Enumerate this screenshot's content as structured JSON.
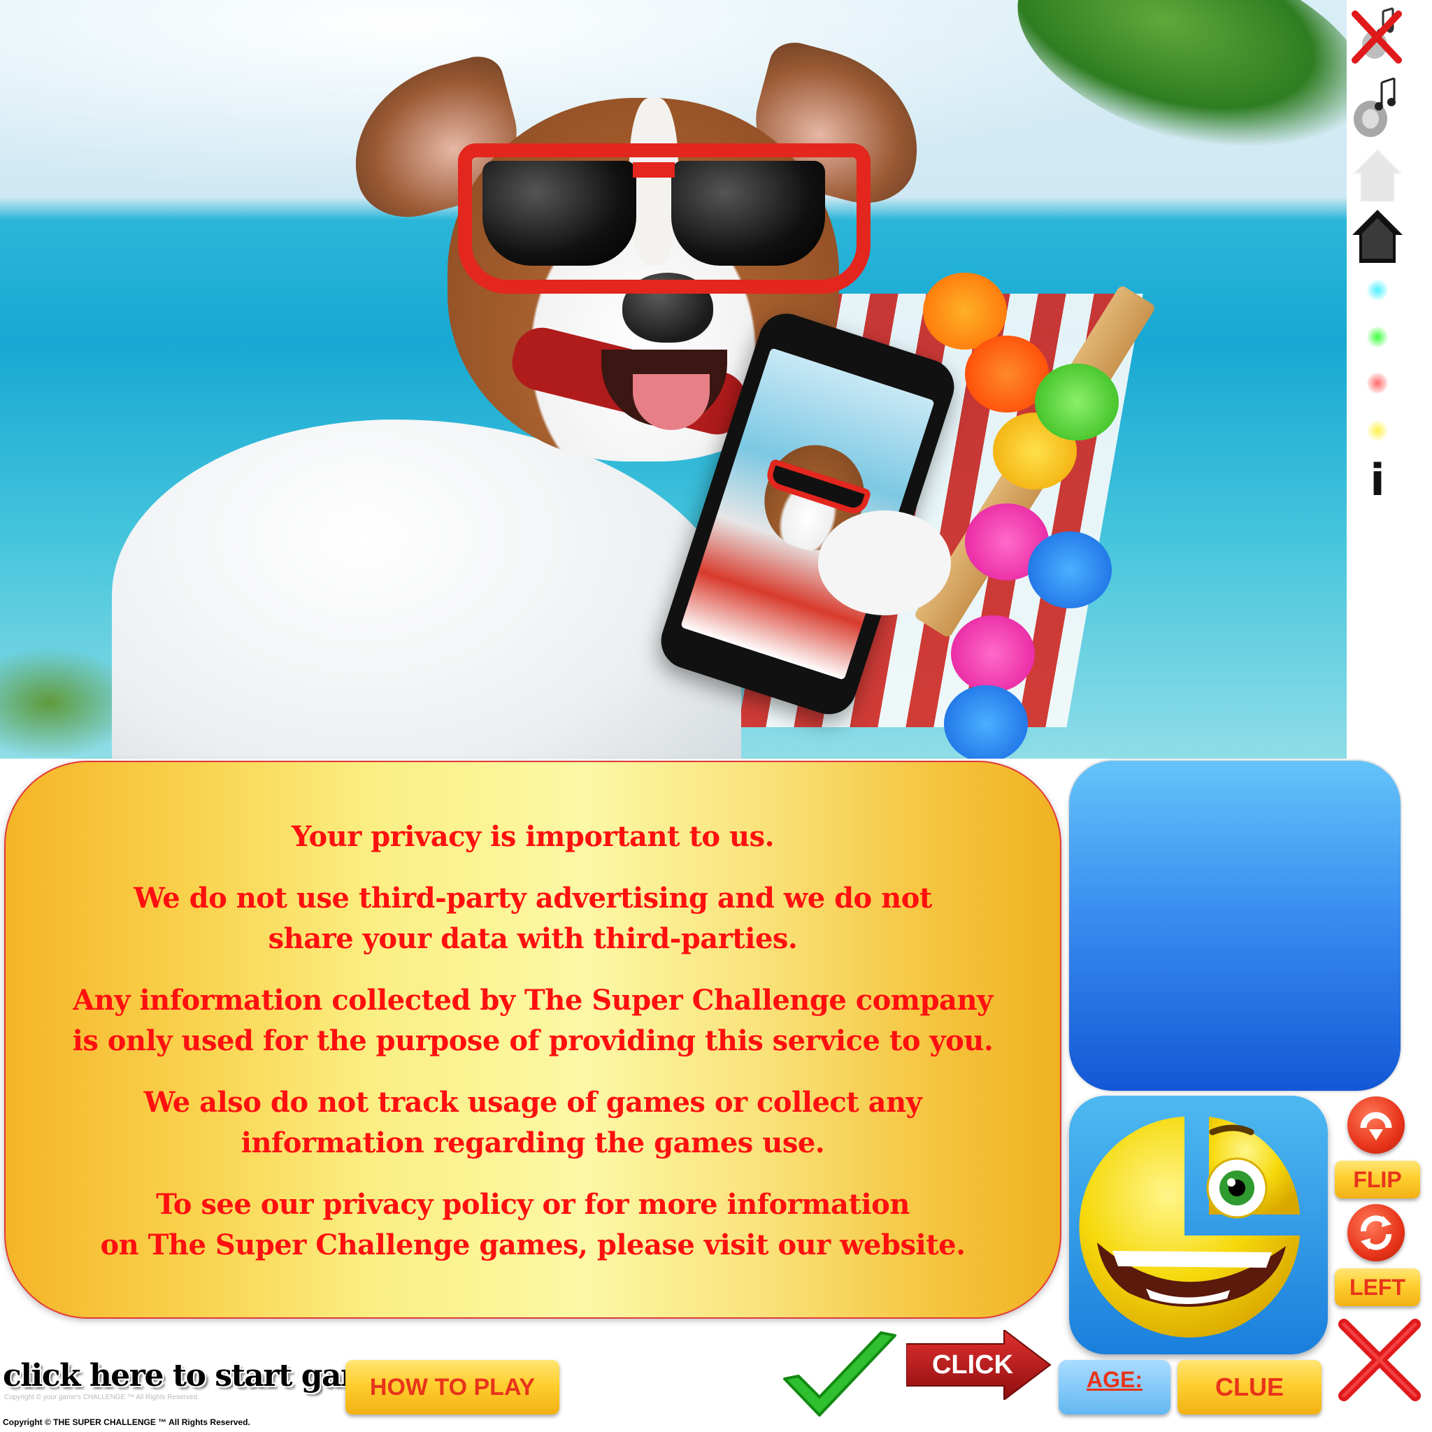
{
  "privacy_message": {
    "paragraphs": [
      "Your privacy is important to us.",
      "We do not use third-party advertising and we do not\nshare your data with third-parties.",
      "Any information collected by The Super Challenge company\nis only used for the purpose of providing this service to you.",
      "We also do not track usage of games or collect any\ninformation regarding the games use.",
      "To see our privacy policy or for more information\non The Super Challenge games, please visit our website."
    ]
  },
  "toolbar": {
    "icons": [
      "sound-off-icon",
      "music-icon",
      "home-outline-icon",
      "home-icon",
      "cyan-dot-icon",
      "green-dot-icon",
      "red-dot-icon",
      "yellow-dot-icon",
      "info-icon"
    ],
    "info_label": "i"
  },
  "side_controls": {
    "flip_label": "FLIP",
    "left_label": "LEFT"
  },
  "bottom_bar": {
    "start_game": "click here to start game",
    "how_to_play": "HOW TO PLAY",
    "click_label": "CLICK",
    "age_label": "AGE:",
    "clue_label": "CLUE",
    "copyright": "Copyright © THE SUPER CHALLENGE ™ All Rights Reserved.",
    "copyright_faint": "Copyright © your game's CHALLENGE ™ All Rights Reserved."
  },
  "colors": {
    "message_text": "#ff0f0f",
    "gold_button": "#ffcf2f",
    "accent_red": "#e8341a",
    "blue_panel": "#3b8ef0"
  }
}
